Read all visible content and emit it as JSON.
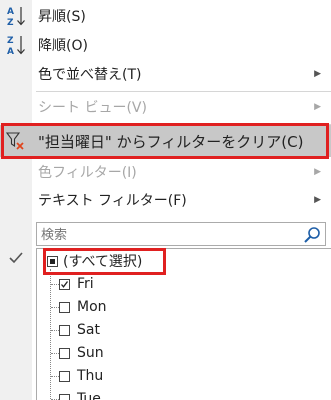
{
  "menu": {
    "sort_asc": {
      "label": "昇順(S)",
      "icon": "sort-ascending-icon"
    },
    "sort_desc": {
      "label": "降順(O)",
      "icon": "sort-descending-icon"
    },
    "sort_by_color": {
      "label": "色で並べ替え(T)",
      "submenu": "▶"
    },
    "sheet_view": {
      "label": "シート ビュー(V)",
      "submenu": "▶"
    },
    "clear_filter": {
      "label": "\"担当曜日\" からフィルターをクリア(C)",
      "icon": "clear-filter-icon"
    },
    "color_filter": {
      "label": "色フィルター(I)",
      "submenu": "▶"
    },
    "text_filter": {
      "label": "テキスト フィルター(F)",
      "submenu": "▶"
    }
  },
  "search": {
    "placeholder": "検索",
    "value": ""
  },
  "filter_list": {
    "select_all": {
      "label": "(すべて選択)",
      "state": "partial"
    },
    "items": [
      {
        "label": "Fri",
        "checked": true
      },
      {
        "label": "Mon",
        "checked": false
      },
      {
        "label": "Sat",
        "checked": false
      },
      {
        "label": "Sun",
        "checked": false
      },
      {
        "label": "Thu",
        "checked": false
      },
      {
        "label": "Tue",
        "checked": false
      }
    ]
  },
  "colors": {
    "highlight": "#c8c8c8",
    "outline": "#e02020",
    "clear_x": "#e0441c",
    "search_icon": "#1f5fa8"
  }
}
